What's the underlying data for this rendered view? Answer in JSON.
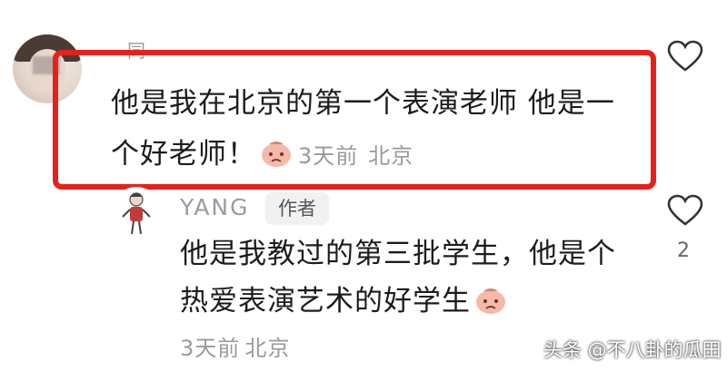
{
  "comment_1": {
    "name": "同",
    "text_line1": "他是我在北京的第一个表演老师 他是一",
    "text_line2": "个好老师！",
    "emoji": "sad-face-emoji",
    "time": "3天前",
    "location": "北京"
  },
  "reply_1": {
    "name": "YANG",
    "badge": "作者",
    "text_line1": "他是我教过的第三批学生，他是个",
    "text_line2": "热爱表演艺术的好学生",
    "emoji": "sad-face-emoji",
    "time": "3天前",
    "location": "北京",
    "like_count": "2"
  },
  "watermark": "头条 @不八卦的瓜田",
  "colors": {
    "highlight": "#e8201c",
    "meta_text": "#9a9a9a"
  }
}
